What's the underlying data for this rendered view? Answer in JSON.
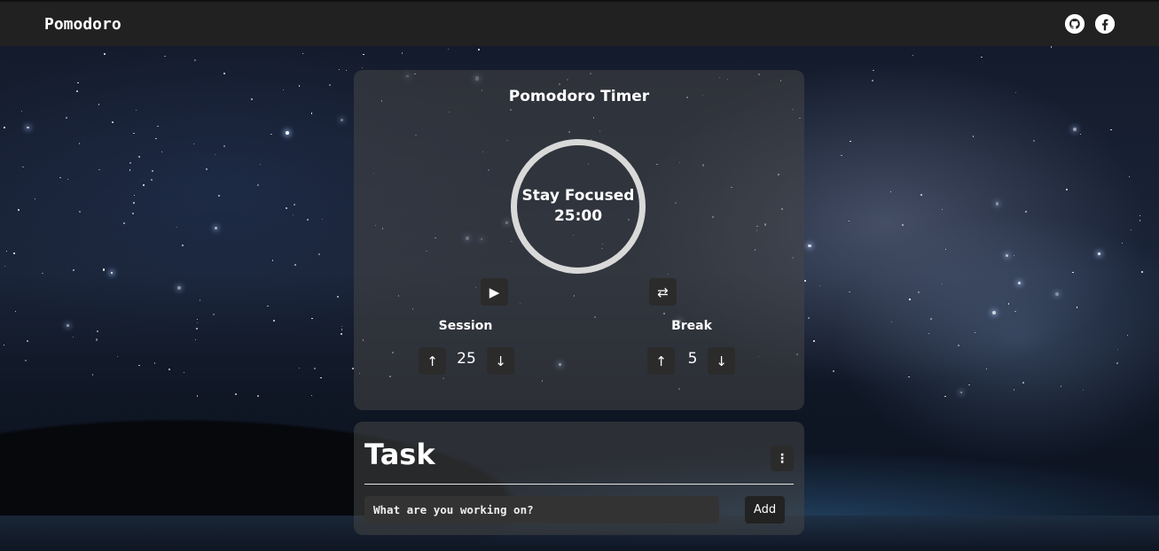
{
  "navbar": {
    "brand": "Pomodoro",
    "icons": [
      "github-icon",
      "facebook-icon"
    ]
  },
  "timer": {
    "title": "Pomodoro Timer",
    "status": "Stay Focused",
    "time": "25:00",
    "play_icon": "▶",
    "reset_icon": "⇄",
    "session": {
      "label": "Session",
      "value": "25",
      "up_icon": "↑",
      "down_icon": "↓"
    },
    "break": {
      "label": "Break",
      "value": "5",
      "up_icon": "↑",
      "down_icon": "↓"
    }
  },
  "task": {
    "title": "Task",
    "menu_icon": "⋮",
    "input_placeholder": "What are you working on?",
    "add_label": "Add"
  },
  "colors": {
    "navbar": "#212121",
    "ring": "#d9d9d9",
    "button": "#2b2b2b"
  }
}
